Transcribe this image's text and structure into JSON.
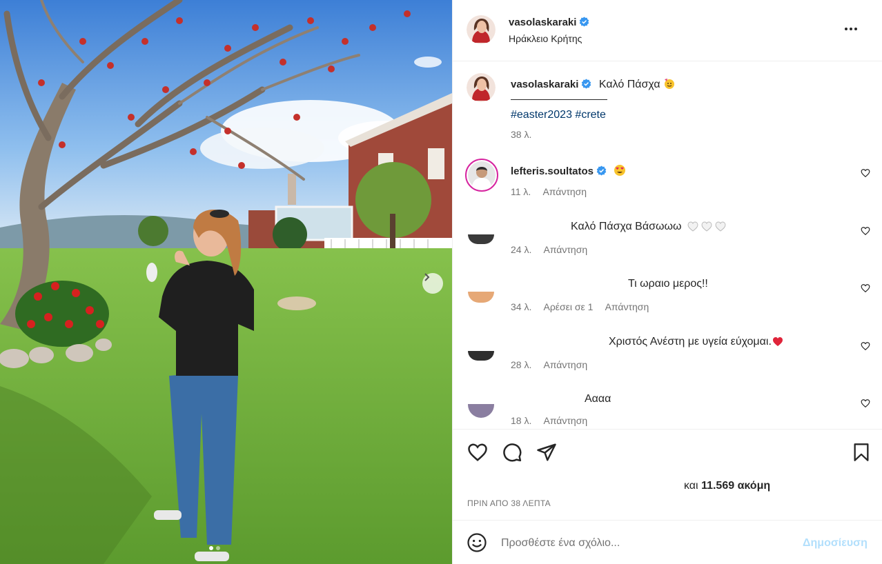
{
  "post": {
    "username": "vasolaskaraki",
    "location": "Ηράκλειο Κρήτης",
    "caption": "Καλό Πάσχα",
    "hashtags": [
      "#easter2023",
      "#crete"
    ],
    "caption_time": "38 λ.",
    "likes_prefix": "και",
    "likes_count": "11.569 ακόμη",
    "posted_time": "ΠΡΙΝ ΑΠΟ 38 ΛΕΠΤΑ"
  },
  "comments": [
    {
      "username": "lefteris.soultatos",
      "text": "",
      "time": "11 λ.",
      "likes": "",
      "reply": "Απάντηση"
    },
    {
      "username": "",
      "text": "Καλό Πάσχα Βάσωωω",
      "time": "24 λ.",
      "likes": "",
      "reply": "Απάντηση"
    },
    {
      "username": "",
      "text": "Τι ωραιο μερος!!",
      "time": "34 λ.",
      "likes": "Αρέσει σε 1",
      "reply": "Απάντηση"
    },
    {
      "username": "",
      "text": "Χριστός Ανέστη με υγεία εύχομαι.",
      "time": "28 λ.",
      "likes": "",
      "reply": "Απάντηση"
    },
    {
      "username": "",
      "text": "Αααα",
      "time": "18 λ.",
      "likes": "",
      "reply": "Απάντηση"
    }
  ],
  "composer": {
    "placeholder": "Προσθέστε ένα σχόλιο...",
    "post_label": "Δημοσίευση"
  },
  "colors": {
    "verified": "#3897f0",
    "link": "#00376b",
    "post_disabled": "#b2dffc",
    "meta": "#737373"
  }
}
